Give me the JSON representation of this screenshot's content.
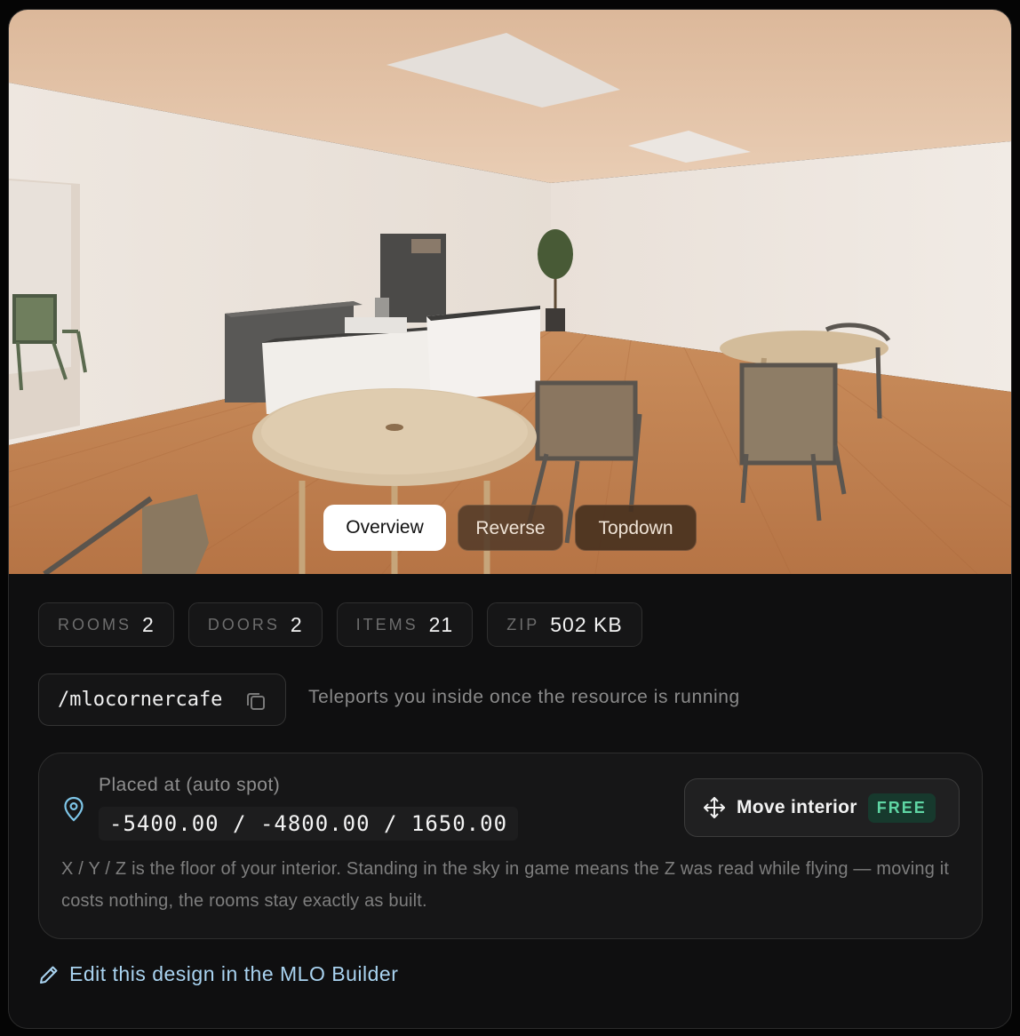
{
  "preview": {
    "image_alt": "3D render of a corner cafe interior",
    "views": [
      "Overview",
      "Reverse",
      "Topdown"
    ],
    "active_view": "Overview"
  },
  "stats": [
    {
      "key": "ROOMS",
      "value": "2"
    },
    {
      "key": "DOORS",
      "value": "2"
    },
    {
      "key": "ITEMS",
      "value": "21"
    },
    {
      "key": "ZIP",
      "value": "502 KB"
    }
  ],
  "command": {
    "text": "/mlocornercafe",
    "hint": "Teleports you inside once the resource is running"
  },
  "placement": {
    "label": "Placed at (auto spot)",
    "coords": "-5400.00 / -4800.00 / 1650.00",
    "move_label": "Move interior",
    "move_badge": "FREE",
    "note": "X / Y / Z is the floor of your interior. Standing in the sky in game means the Z was read while flying — moving it costs nothing, the rooms stay exactly as built."
  },
  "edit_link": "Edit this design in the MLO Builder",
  "colors": {
    "accent_link": "#a9d3f0",
    "free_badge_bg": "#17392d",
    "free_badge_text": "#5fd6a4",
    "pin_icon": "#7ec6e8"
  },
  "icons": [
    "copy-icon",
    "map-pin-icon",
    "move-icon",
    "pencil-icon"
  ]
}
